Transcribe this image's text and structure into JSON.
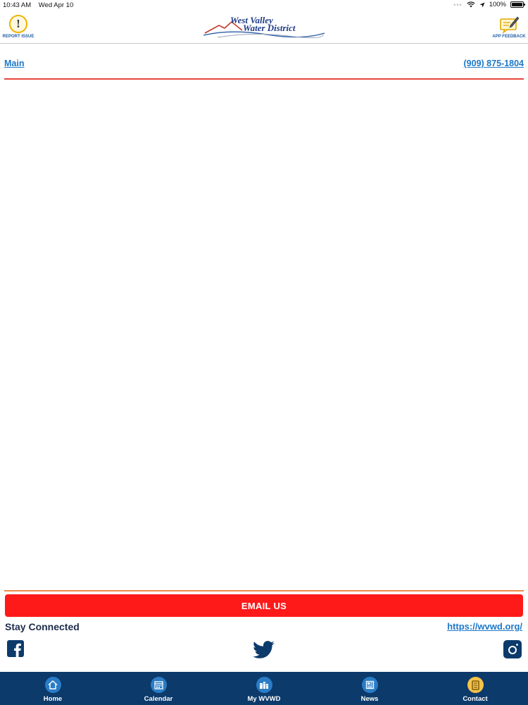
{
  "status_bar": {
    "time": "10:43 AM",
    "date": "Wed Apr 10",
    "battery": "100%"
  },
  "header": {
    "report_label": "REPORT ISSUE",
    "feedback_label": "APP FEEDBACK",
    "logo_line1": "West Valley",
    "logo_line2": "Water District"
  },
  "nav": {
    "main_link": "Main",
    "phone": "(909) 875-1804"
  },
  "footer": {
    "email_button": "EMAIL US",
    "stay_connected": "Stay Connected",
    "website": "https://wvwd.org/",
    "social": [
      "facebook-icon",
      "twitter-icon",
      "instagram-icon"
    ]
  },
  "tabs": [
    {
      "label": "Home",
      "icon": "home-icon"
    },
    {
      "label": "Calendar",
      "icon": "calendar-icon"
    },
    {
      "label": "My WVWD",
      "icon": "building-icon"
    },
    {
      "label": "News",
      "icon": "news-icon"
    },
    {
      "label": "Contact",
      "icon": "contact-book-icon",
      "active": true
    }
  ],
  "colors": {
    "brand_blue": "#0c3a6b",
    "link_blue": "#1d78c8",
    "email_red": "#ff1a1a",
    "active_tab": "#f5c34a"
  }
}
